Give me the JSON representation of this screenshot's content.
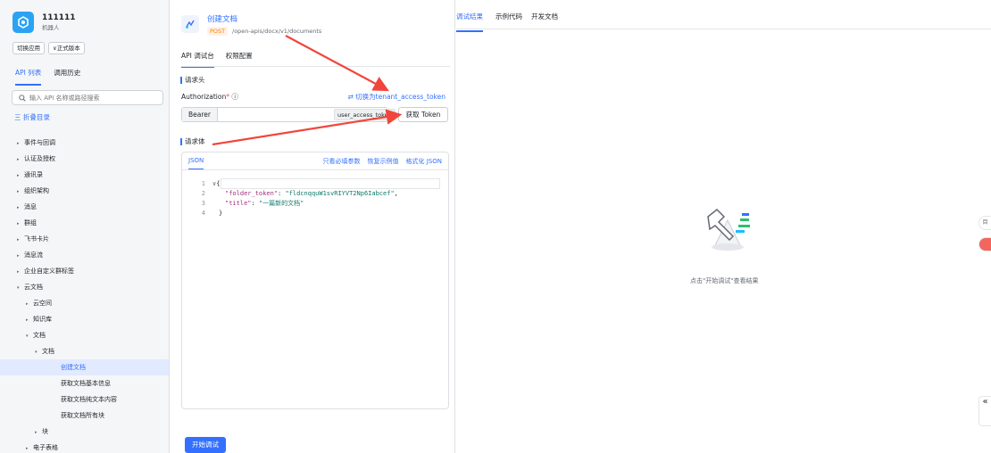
{
  "app": {
    "name": "111111",
    "role": "机器人",
    "switch_label": "切换应用",
    "version_label": "正式版本"
  },
  "sidebar": {
    "tabs": [
      "API 列表",
      "调用历史"
    ],
    "search_placeholder": "输入 API 名称或路径搜索",
    "collapse_all": "三 折叠目录",
    "items": [
      {
        "label": "事件与回调",
        "depth": 0,
        "arrow": "▸"
      },
      {
        "label": "认证及授权",
        "depth": 0,
        "arrow": "▸"
      },
      {
        "label": "通讯录",
        "depth": 0,
        "arrow": "▸"
      },
      {
        "label": "组织架构",
        "depth": 0,
        "arrow": "▸"
      },
      {
        "label": "消息",
        "depth": 0,
        "arrow": "▸"
      },
      {
        "label": "群组",
        "depth": 0,
        "arrow": "▸"
      },
      {
        "label": "飞书卡片",
        "depth": 0,
        "arrow": "▸"
      },
      {
        "label": "消息流",
        "depth": 0,
        "arrow": "▸"
      },
      {
        "label": "企业自定义群标签",
        "depth": 0,
        "arrow": "▸"
      },
      {
        "label": "云文档",
        "depth": 0,
        "arrow": "▾"
      },
      {
        "label": "云空间",
        "depth": 1,
        "arrow": "▸"
      },
      {
        "label": "知识库",
        "depth": 1,
        "arrow": "▸"
      },
      {
        "label": "文档",
        "depth": 1,
        "arrow": "▾"
      },
      {
        "label": "文档",
        "depth": 2,
        "arrow": "▾"
      },
      {
        "label": "创建文档",
        "depth": 3,
        "arrow": "",
        "active": true
      },
      {
        "label": "获取文档基本信息",
        "depth": 3,
        "arrow": ""
      },
      {
        "label": "获取文档纯文本内容",
        "depth": 3,
        "arrow": ""
      },
      {
        "label": "获取文档所有块",
        "depth": 3,
        "arrow": ""
      },
      {
        "label": "块",
        "depth": 2,
        "arrow": "▸"
      },
      {
        "label": "电子表格",
        "depth": 1,
        "arrow": "▸"
      }
    ]
  },
  "api": {
    "title": "创建文档",
    "method": "POST",
    "path": "/open-apis/docx/v1/documents",
    "tabs": [
      "API 调试台",
      "权限配置"
    ],
    "header_section": "请求头",
    "auth_label": "Authorization",
    "auth_required": "*",
    "auth_switch": "⇄ 切换为tenant_access_token",
    "token_prefix": "Bearer",
    "token_type": "user_access_token",
    "get_token": "获取 Token",
    "body_section": "请求体",
    "body_tab": "JSON",
    "body_actions": [
      "只看必填参数",
      "恢复示例值",
      "格式化 JSON"
    ],
    "code_lines": [
      {
        "no": "1",
        "text": "{"
      },
      {
        "no": "2",
        "key": "\"folder_token\"",
        "value": "\"fldcnqquW1svRIYVT2Np6Iabcef\"",
        "tail": ","
      },
      {
        "no": "3",
        "key": "\"title\"",
        "value": "\"一篇新的文档\"",
        "tail": ""
      },
      {
        "no": "4",
        "text": "}"
      }
    ],
    "start_button": "开始调试"
  },
  "result": {
    "tabs": [
      "调试结果",
      "示例代码",
      "开发文档"
    ],
    "empty_text": "点击\"开始调试\"查看结果",
    "float_labels": [
      "目",
      ""
    ],
    "collapse_label": "«"
  },
  "colors": {
    "accent": "#3370ff",
    "annotation": "#f0463c",
    "method": "#ff7d00"
  }
}
